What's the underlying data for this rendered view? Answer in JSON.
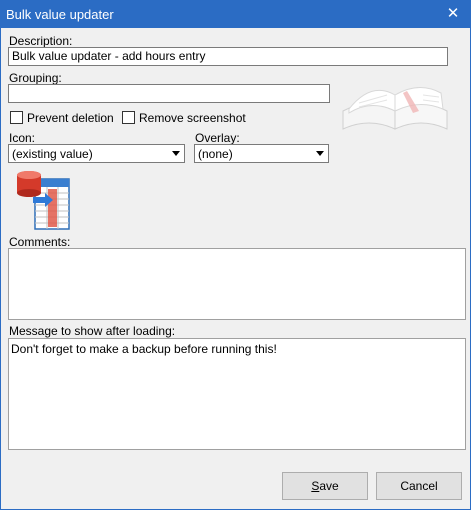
{
  "window": {
    "title": "Bulk value updater",
    "close_glyph": "✕"
  },
  "fields": {
    "description_label": "Description:",
    "description_value": "Bulk value updater - add hours entry",
    "grouping_label": "Grouping:",
    "grouping_value": "",
    "prevent_deletion_label": "Prevent deletion",
    "prevent_deletion_checked": false,
    "remove_screenshot_label": "Remove screenshot",
    "remove_screenshot_checked": false,
    "icon_label": "Icon:",
    "icon_value": "(existing value)",
    "overlay_label": "Overlay:",
    "overlay_value": "(none)",
    "comments_label": "Comments:",
    "comments_value": "",
    "message_label": "Message to show after loading:",
    "message_value": "Don't forget to make a backup before running this!"
  },
  "buttons": {
    "save": "Save",
    "cancel": "Cancel"
  },
  "icons": {
    "book": "open-book-icon",
    "preview": "database-table-icon"
  },
  "colors": {
    "titlebar": "#2b6cc4",
    "window_bg": "#f0f0f0"
  }
}
